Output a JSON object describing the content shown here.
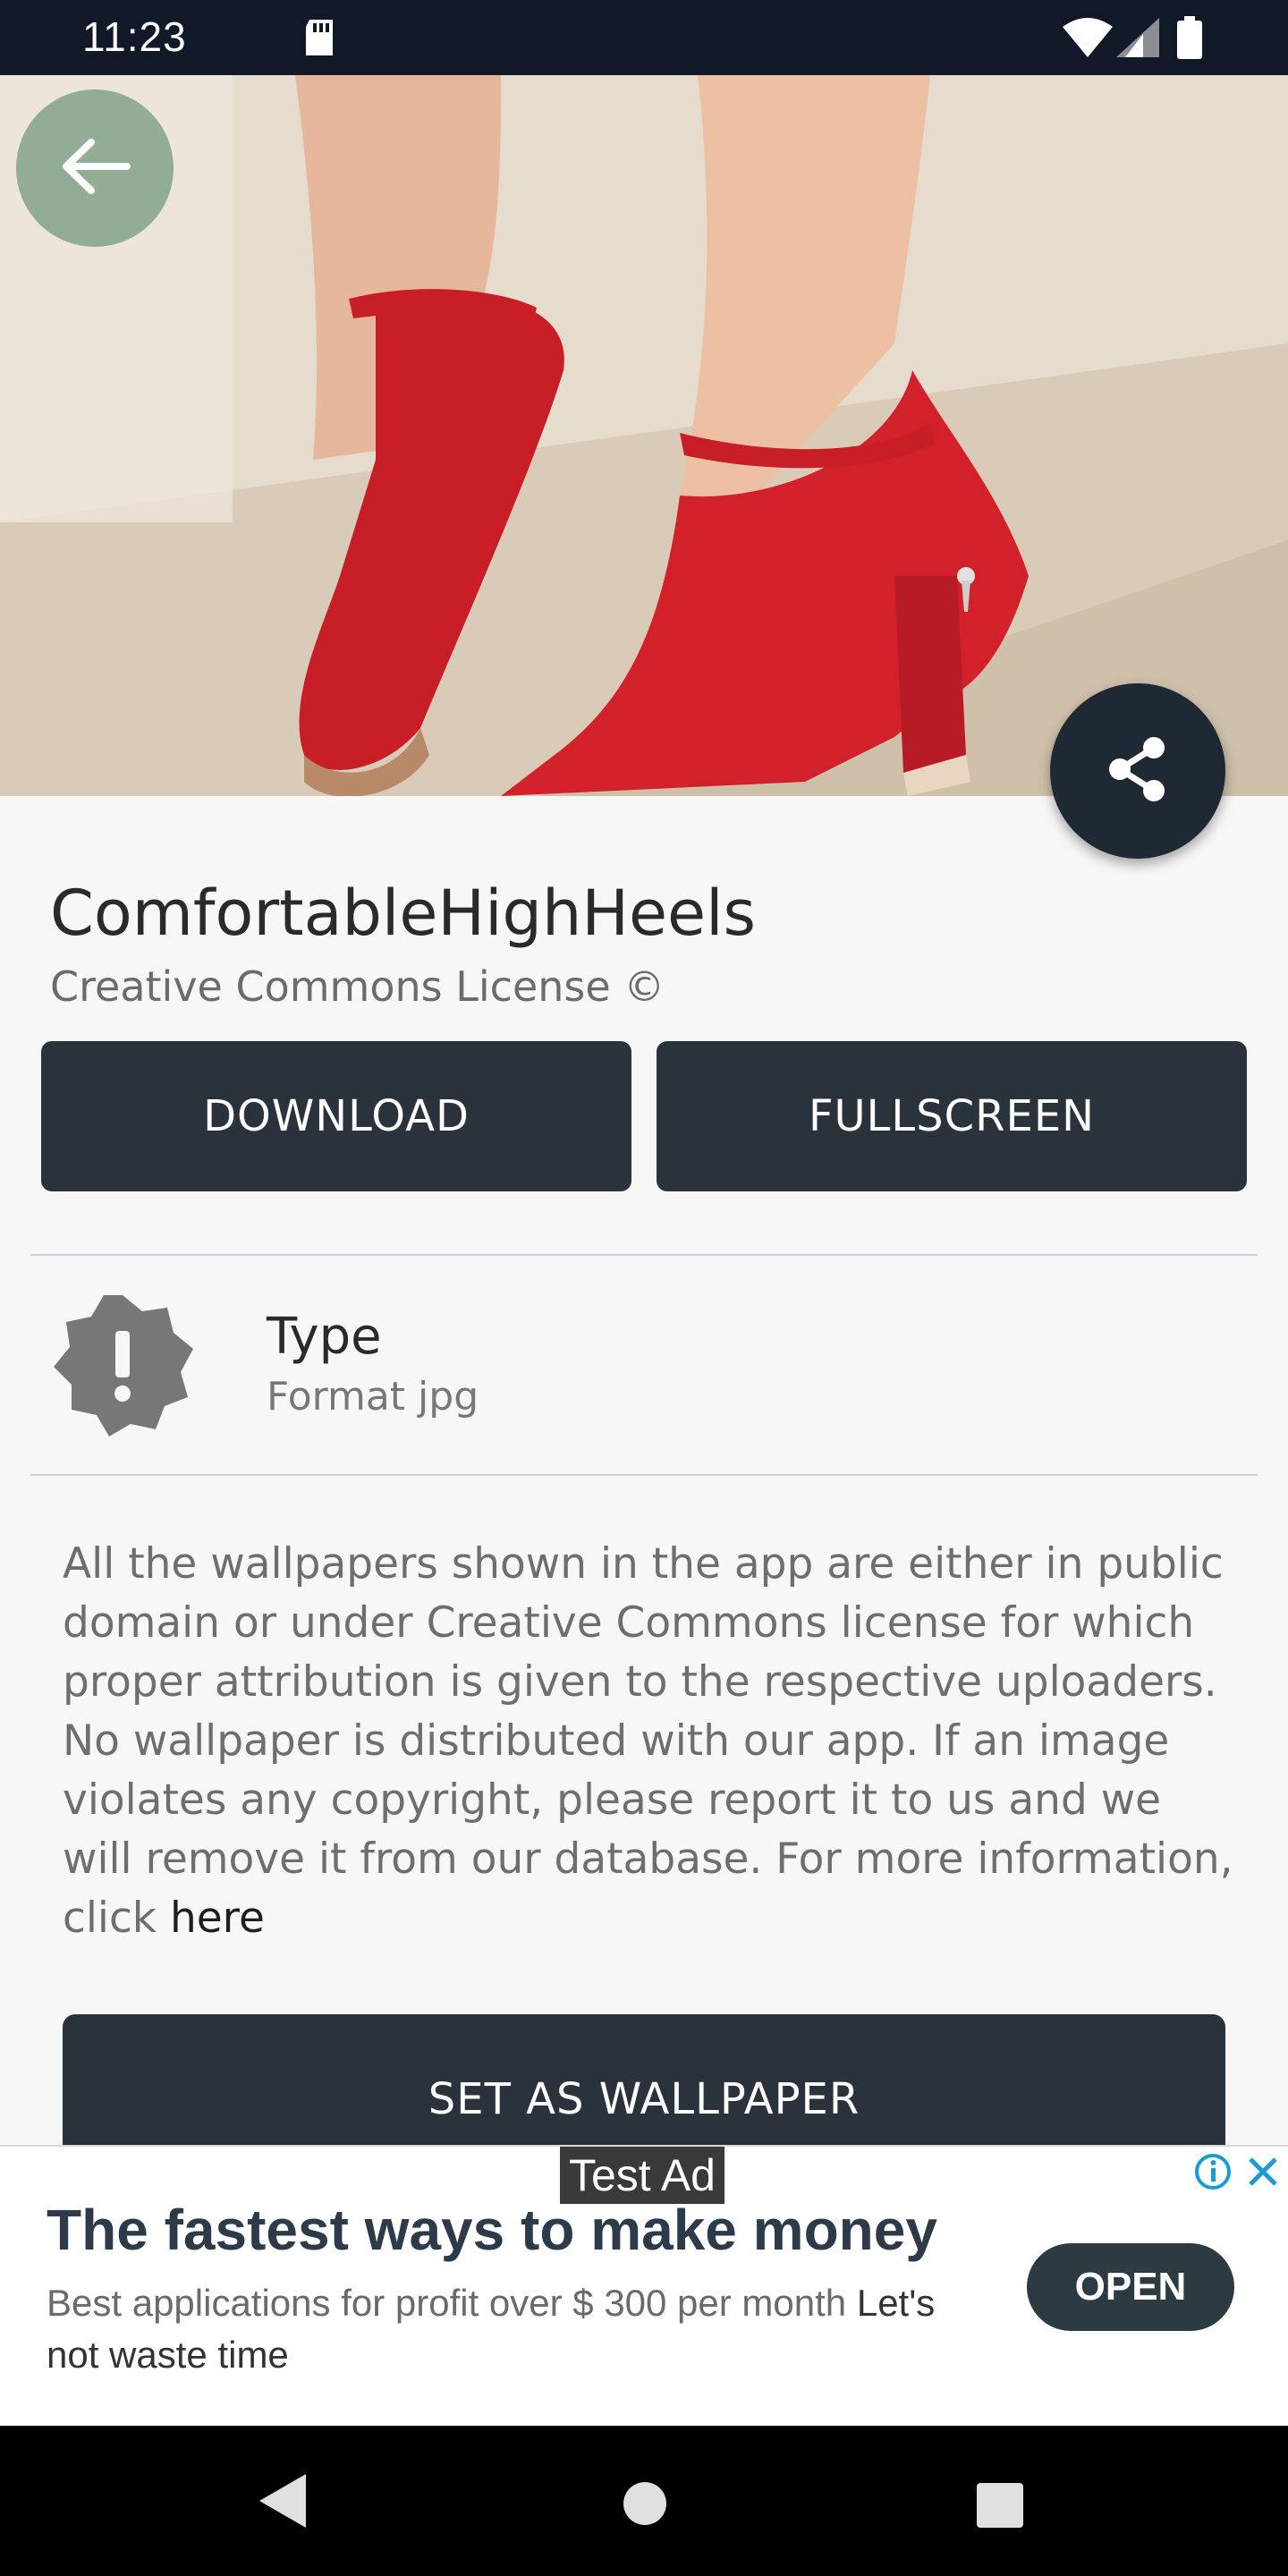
{
  "status_bar": {
    "time": "11:23",
    "icons": [
      "sd-card-icon",
      "wifi-icon",
      "signal-icon",
      "battery-icon"
    ]
  },
  "hero": {
    "description_icon": "red-high-heels-image",
    "back_icon": "back-arrow-icon",
    "share_icon": "share-icon"
  },
  "wallpaper": {
    "title": "ComfortableHighHeels",
    "license": "Creative Commons License ©"
  },
  "actions": {
    "download_label": "DOWNLOAD",
    "fullscreen_label": "FULLSCREEN",
    "set_wallpaper_label": "SET AS WALLPAPER"
  },
  "info": {
    "type_title": "Type",
    "type_value": "Format jpg",
    "icon": "alert-badge-icon"
  },
  "notice": {
    "text": "All the wallpapers shown in the app are either in public domain or under Creative Commons license for which proper attribution is given to the respective uploaders. No wallpaper is distributed with our app. If an image violates any copyright, please report it to us and we will remove it from our database. For more information, click ",
    "link_text": "here"
  },
  "ad": {
    "label": "Test Ad",
    "headline": "The fastest ways to make money",
    "description": "Best applications for profit over $ 300 per month ",
    "description_cta": "Let's not waste time",
    "open_label": "OPEN"
  },
  "colors": {
    "dark_button": "#2a323c",
    "status_bar": "#111827",
    "background": "#f7f7f7",
    "shoe_red": "#d3212b"
  }
}
